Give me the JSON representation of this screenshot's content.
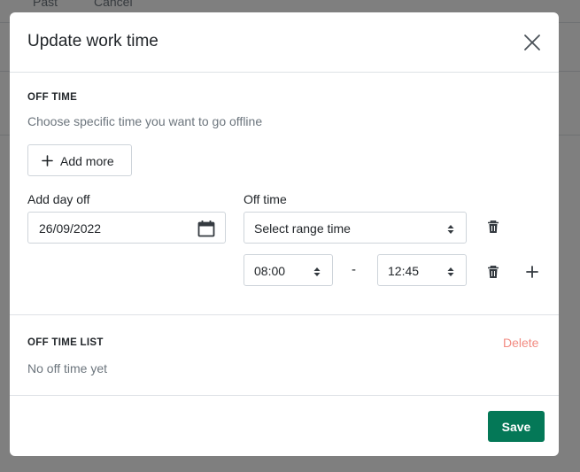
{
  "background": {
    "tabs": [
      "Past",
      "Cancel"
    ]
  },
  "modal": {
    "title": "Update work time",
    "close_icon": "close-icon"
  },
  "off_time": {
    "section_title": "OFF TIME",
    "hint": "Choose specific time you want to go offline",
    "add_more_label": "Add more",
    "add_day_off_label": "Add day off",
    "date_value": "26/09/2022",
    "off_time_label": "Off time",
    "range_select_value": "Select range time",
    "start_time": "08:00",
    "separator": "-",
    "end_time": "12:45"
  },
  "off_time_list": {
    "section_title": "OFF TIME LIST",
    "delete_label": "Delete",
    "empty_text": "No off time yet"
  },
  "footer": {
    "save_label": "Save"
  },
  "colors": {
    "primary": "#047857",
    "danger_soft": "#f28b82",
    "muted_text": "#6c757d",
    "border": "#ced4da"
  }
}
